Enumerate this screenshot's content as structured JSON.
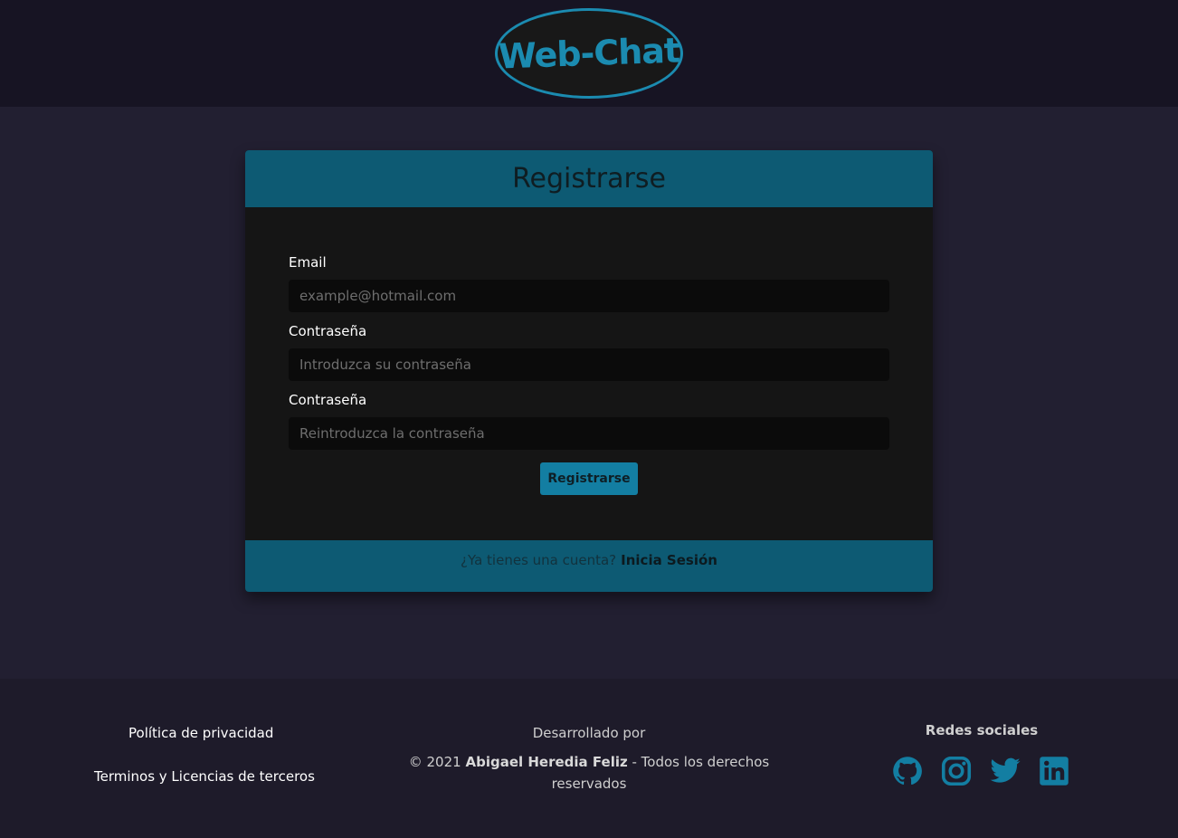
{
  "header": {
    "logo_text": "Web-Chat"
  },
  "card": {
    "title": "Registrarse",
    "fields": [
      {
        "label": "Email",
        "placeholder": "example@hotmail.com"
      },
      {
        "label": "Contraseña",
        "placeholder": "Introduzca su contraseña"
      },
      {
        "label": "Contraseña",
        "placeholder": "Reintroduzca la contraseña"
      }
    ],
    "submit_label": "Registrarse",
    "footer_text": "¿Ya tienes una cuenta?",
    "footer_link": "Inicia Sesión"
  },
  "footer": {
    "privacy": "Política de privacidad",
    "terms": "Terminos y Licencias de terceros",
    "developed_by": "Desarrollado por",
    "copyright_prefix": "© 2021",
    "author": "Abigael Heredia Feliz",
    "copyright_suffix": "- Todos los derechos reservados",
    "social_title": "Redes sociales",
    "social_icons": [
      "github-icon",
      "instagram-icon",
      "twitter-icon",
      "linkedin-icon"
    ]
  },
  "colors": {
    "accent": "#137ea2",
    "card_header": "#0d5a73",
    "page_bg": "#221f31"
  }
}
